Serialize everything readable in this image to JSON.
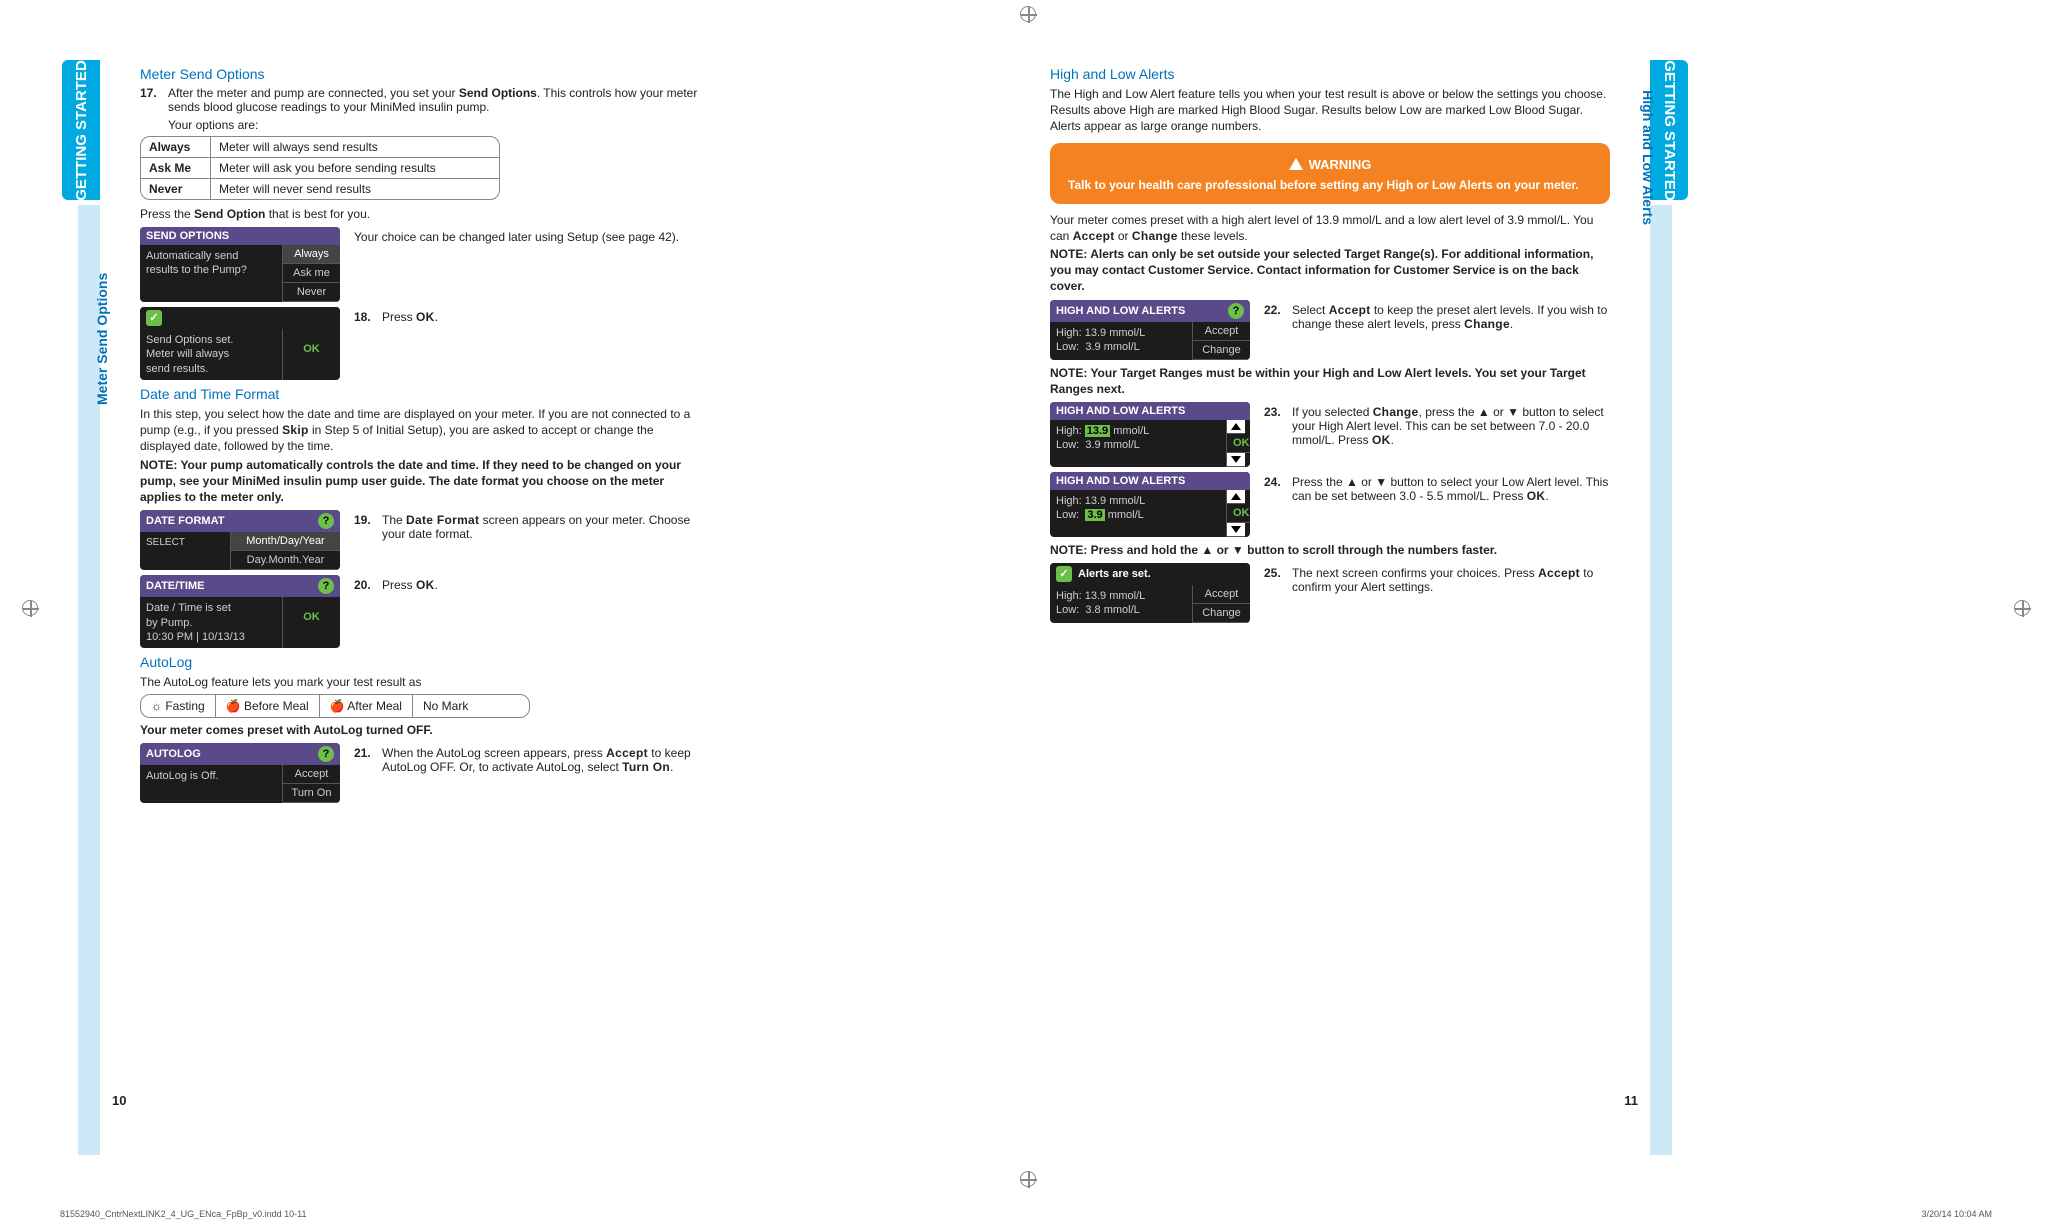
{
  "tabs": {
    "getting": "GETTING\nSTARTED",
    "left_section": "Meter Send Options",
    "right_section": "High and Low Alerts"
  },
  "left": {
    "h1": "Meter Send Options",
    "step17_num": "17.",
    "step17": "After the meter and pump are connected, you set your ",
    "step17_bold": "Send Options",
    "step17_cont": ". This controls how your meter sends blood glucose readings to your MiniMed insulin pump.",
    "options_intro": "Your options are:",
    "opt": [
      {
        "k": "Always",
        "v": "Meter will always send results"
      },
      {
        "k": "Ask Me",
        "v": "Meter will ask you before sending results"
      },
      {
        "k": "Never",
        "v": "Meter will never send results"
      }
    ],
    "press_send": "Press the ",
    "press_send_bold": "Send Option",
    "press_send_end": " that is best for you.",
    "meter_send": {
      "title": "SEND OPTIONS",
      "line1": "Automatically send",
      "line2": "results to the Pump?",
      "opts": [
        "Always",
        "Ask me",
        "Never"
      ]
    },
    "choice_note": "Your choice can be changed later using Setup (see page 42).",
    "meter_confirm": {
      "l1": "Send Options set.",
      "l2": "Meter will always",
      "l3": "send results.",
      "ok": "OK"
    },
    "step18_num": "18.",
    "step18": "Press ",
    "step18_mono": "OK",
    "h2": "Date and Time Format",
    "dt_para": "In this step, you select how the date and time are displayed on your meter. If you are not connected to a pump (e.g., if you pressed ",
    "dt_para_mono": "Skip",
    "dt_para_end": " in Step 5 of Initial Setup), you are asked to accept or change the displayed date, followed by the time.",
    "dt_note": "NOTE: Your pump automatically controls the date and time. If they need to be changed on your pump, see your MiniMed insulin pump user guide. The date format you choose on the meter applies to the meter only.",
    "meter_date": {
      "title": "DATE FORMAT",
      "sel": "SELECT",
      "o1": "Month/Day/Year",
      "o2": "Day.Month.Year"
    },
    "step19_num": "19.",
    "step19a": "The ",
    "step19_mono": "Date Format",
    "step19b": " screen appears on your meter. Choose your date format.",
    "meter_dtset": {
      "title": "DATE/TIME",
      "l1": "Date / Time is set",
      "l2": "by Pump.",
      "l3": "10:30 PM | 10/13/13",
      "ok": "OK"
    },
    "step20_num": "20.",
    "step20": "Press ",
    "step20_mono": "OK",
    "h3": "AutoLog",
    "autolog_intro": "The AutoLog feature lets you mark your test result as",
    "autolog_opts": [
      "☼ Fasting",
      "🍎 Before Meal",
      "🍎 After Meal",
      "No Mark"
    ],
    "autolog_preset": "Your meter comes preset with AutoLog turned OFF.",
    "meter_autolog": {
      "title": "AUTOLOG",
      "line": "AutoLog is Off.",
      "o1": "Accept",
      "o2": "Turn On"
    },
    "step21_num": "21.",
    "step21a": "When the AutoLog screen appears, press ",
    "step21_mono1": "Accept",
    "step21b": " to keep AutoLog OFF. Or, to activate AutoLog, select ",
    "step21_mono2": "Turn On",
    "pagenum": "10"
  },
  "right": {
    "h1": "High and Low Alerts",
    "intro": "The High and Low Alert feature tells you when your test result is above or below the settings you choose. Results above High are marked High Blood Sugar. Results below Low are marked Low Blood Sugar. Alerts appear as large orange numbers.",
    "warn_title": "WARNING",
    "warn_body": "Talk to your health care professional before setting any High or Low Alerts on your meter.",
    "preset": "Your meter comes preset with a high alert level of 13.9 mmol/L and a low alert level of 3.9 mmol/L. You can ",
    "preset_m1": "Accept",
    "preset_or": " or ",
    "preset_m2": "Change",
    "preset_end": " these levels.",
    "note1": "NOTE: Alerts can only be set outside your selected Target Range(s). For additional information, you may contact Customer Service. Contact information for Customer Service is on the back cover.",
    "meter_hl1": {
      "title": "HIGH AND LOW ALERTS",
      "h": "High:",
      "hv": "13.9",
      "u": "mmol/L",
      "l": "Low:",
      "lv": "3.9",
      "o1": "Accept",
      "o2": "Change"
    },
    "step22_num": "22.",
    "step22a": "Select ",
    "step22_m1": "Accept",
    "step22b": " to keep the preset alert levels. If you wish to change these alert levels, press ",
    "step22_m2": "Change",
    "note2": "NOTE: Your Target Ranges must be within your High and Low Alert levels. You set your Target Ranges next.",
    "meter_hl2": {
      "title": "HIGH AND LOW ALERTS",
      "h": "High:",
      "hv": "13.9",
      "u": "mmol/L",
      "l": "Low:",
      "lv": "3.9",
      "ok": "OK"
    },
    "step23_num": "23.",
    "step23a": "If you selected ",
    "step23_m": "Change",
    "step23b": ", press the ▲ or ▼ button to select your High Alert level. This can be set between 7.0 - 20.0 mmol/L. Press ",
    "step23_ok": "OK",
    "meter_hl3": {
      "title": "HIGH AND LOW ALERTS",
      "h": "High:",
      "hv": "13.9",
      "u": "mmol/L",
      "l": "Low:",
      "lv": "3.9",
      "ok": "OK"
    },
    "step24_num": "24.",
    "step24": "Press the ▲ or ▼ button to select your Low Alert level. This can be set between 3.0 - 5.5 mmol/L. Press ",
    "step24_ok": "OK",
    "note3": "NOTE: Press and hold the ▲ or ▼ button to scroll through the numbers faster.",
    "meter_hl4": {
      "title": "Alerts are set.",
      "h": "High:",
      "hv": "13.9",
      "u": "mmol/L",
      "l": "Low:",
      "lv": "3.8",
      "o1": "Accept",
      "o2": "Change"
    },
    "step25_num": "25.",
    "step25a": "The next screen confirms your choices. Press ",
    "step25_m": "Accept",
    "step25b": " to confirm your Alert settings.",
    "pagenum": "11"
  },
  "slug": {
    "left": "81552940_CntrNextLINK2_4_UG_ENca_FpBp_v0.indd   10-11",
    "right": "3/20/14   10:04 AM"
  }
}
